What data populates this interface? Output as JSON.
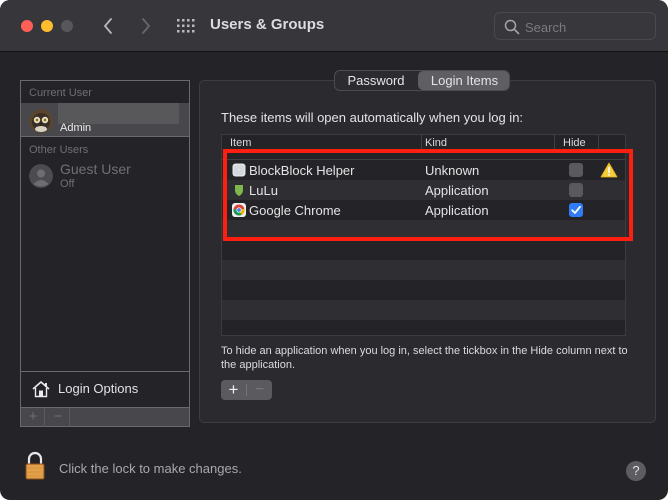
{
  "window": {
    "title": "Users & Groups",
    "search_placeholder": "Search"
  },
  "sidebar": {
    "current_user_header": "Current User",
    "current_user": {
      "name": "",
      "role": "Admin",
      "avatar": "owl-avatar"
    },
    "other_users_header": "Other Users",
    "guest_user": {
      "name": "Guest User",
      "status": "Off"
    },
    "login_options_label": "Login Options",
    "add_label": "+",
    "remove_label": "−"
  },
  "tabs": [
    {
      "label": "Password",
      "selected": false
    },
    {
      "label": "Login Items",
      "selected": true
    }
  ],
  "login_items": {
    "intro": "These items will open automatically when you log in:",
    "columns": {
      "item": "Item",
      "kind": "Kind",
      "hide": "Hide"
    },
    "rows": [
      {
        "name": "BlockBlock Helper",
        "kind": "Unknown",
        "hide": false,
        "icon": "generic-app-icon",
        "warning": true
      },
      {
        "name": "LuLu",
        "kind": "Application",
        "hide": false,
        "icon": "lulu-shield-icon",
        "warning": false
      },
      {
        "name": "Google Chrome",
        "kind": "Application",
        "hide": true,
        "icon": "chrome-icon",
        "warning": false
      }
    ],
    "help_text": "To hide an application when you log in, select the tickbox in the Hide column next to the application.",
    "add_label": "+",
    "remove_label": "−",
    "highlight_color": "#ff1f10"
  },
  "footer": {
    "lock_text": "Click the lock to make changes.",
    "help_label": "?"
  }
}
